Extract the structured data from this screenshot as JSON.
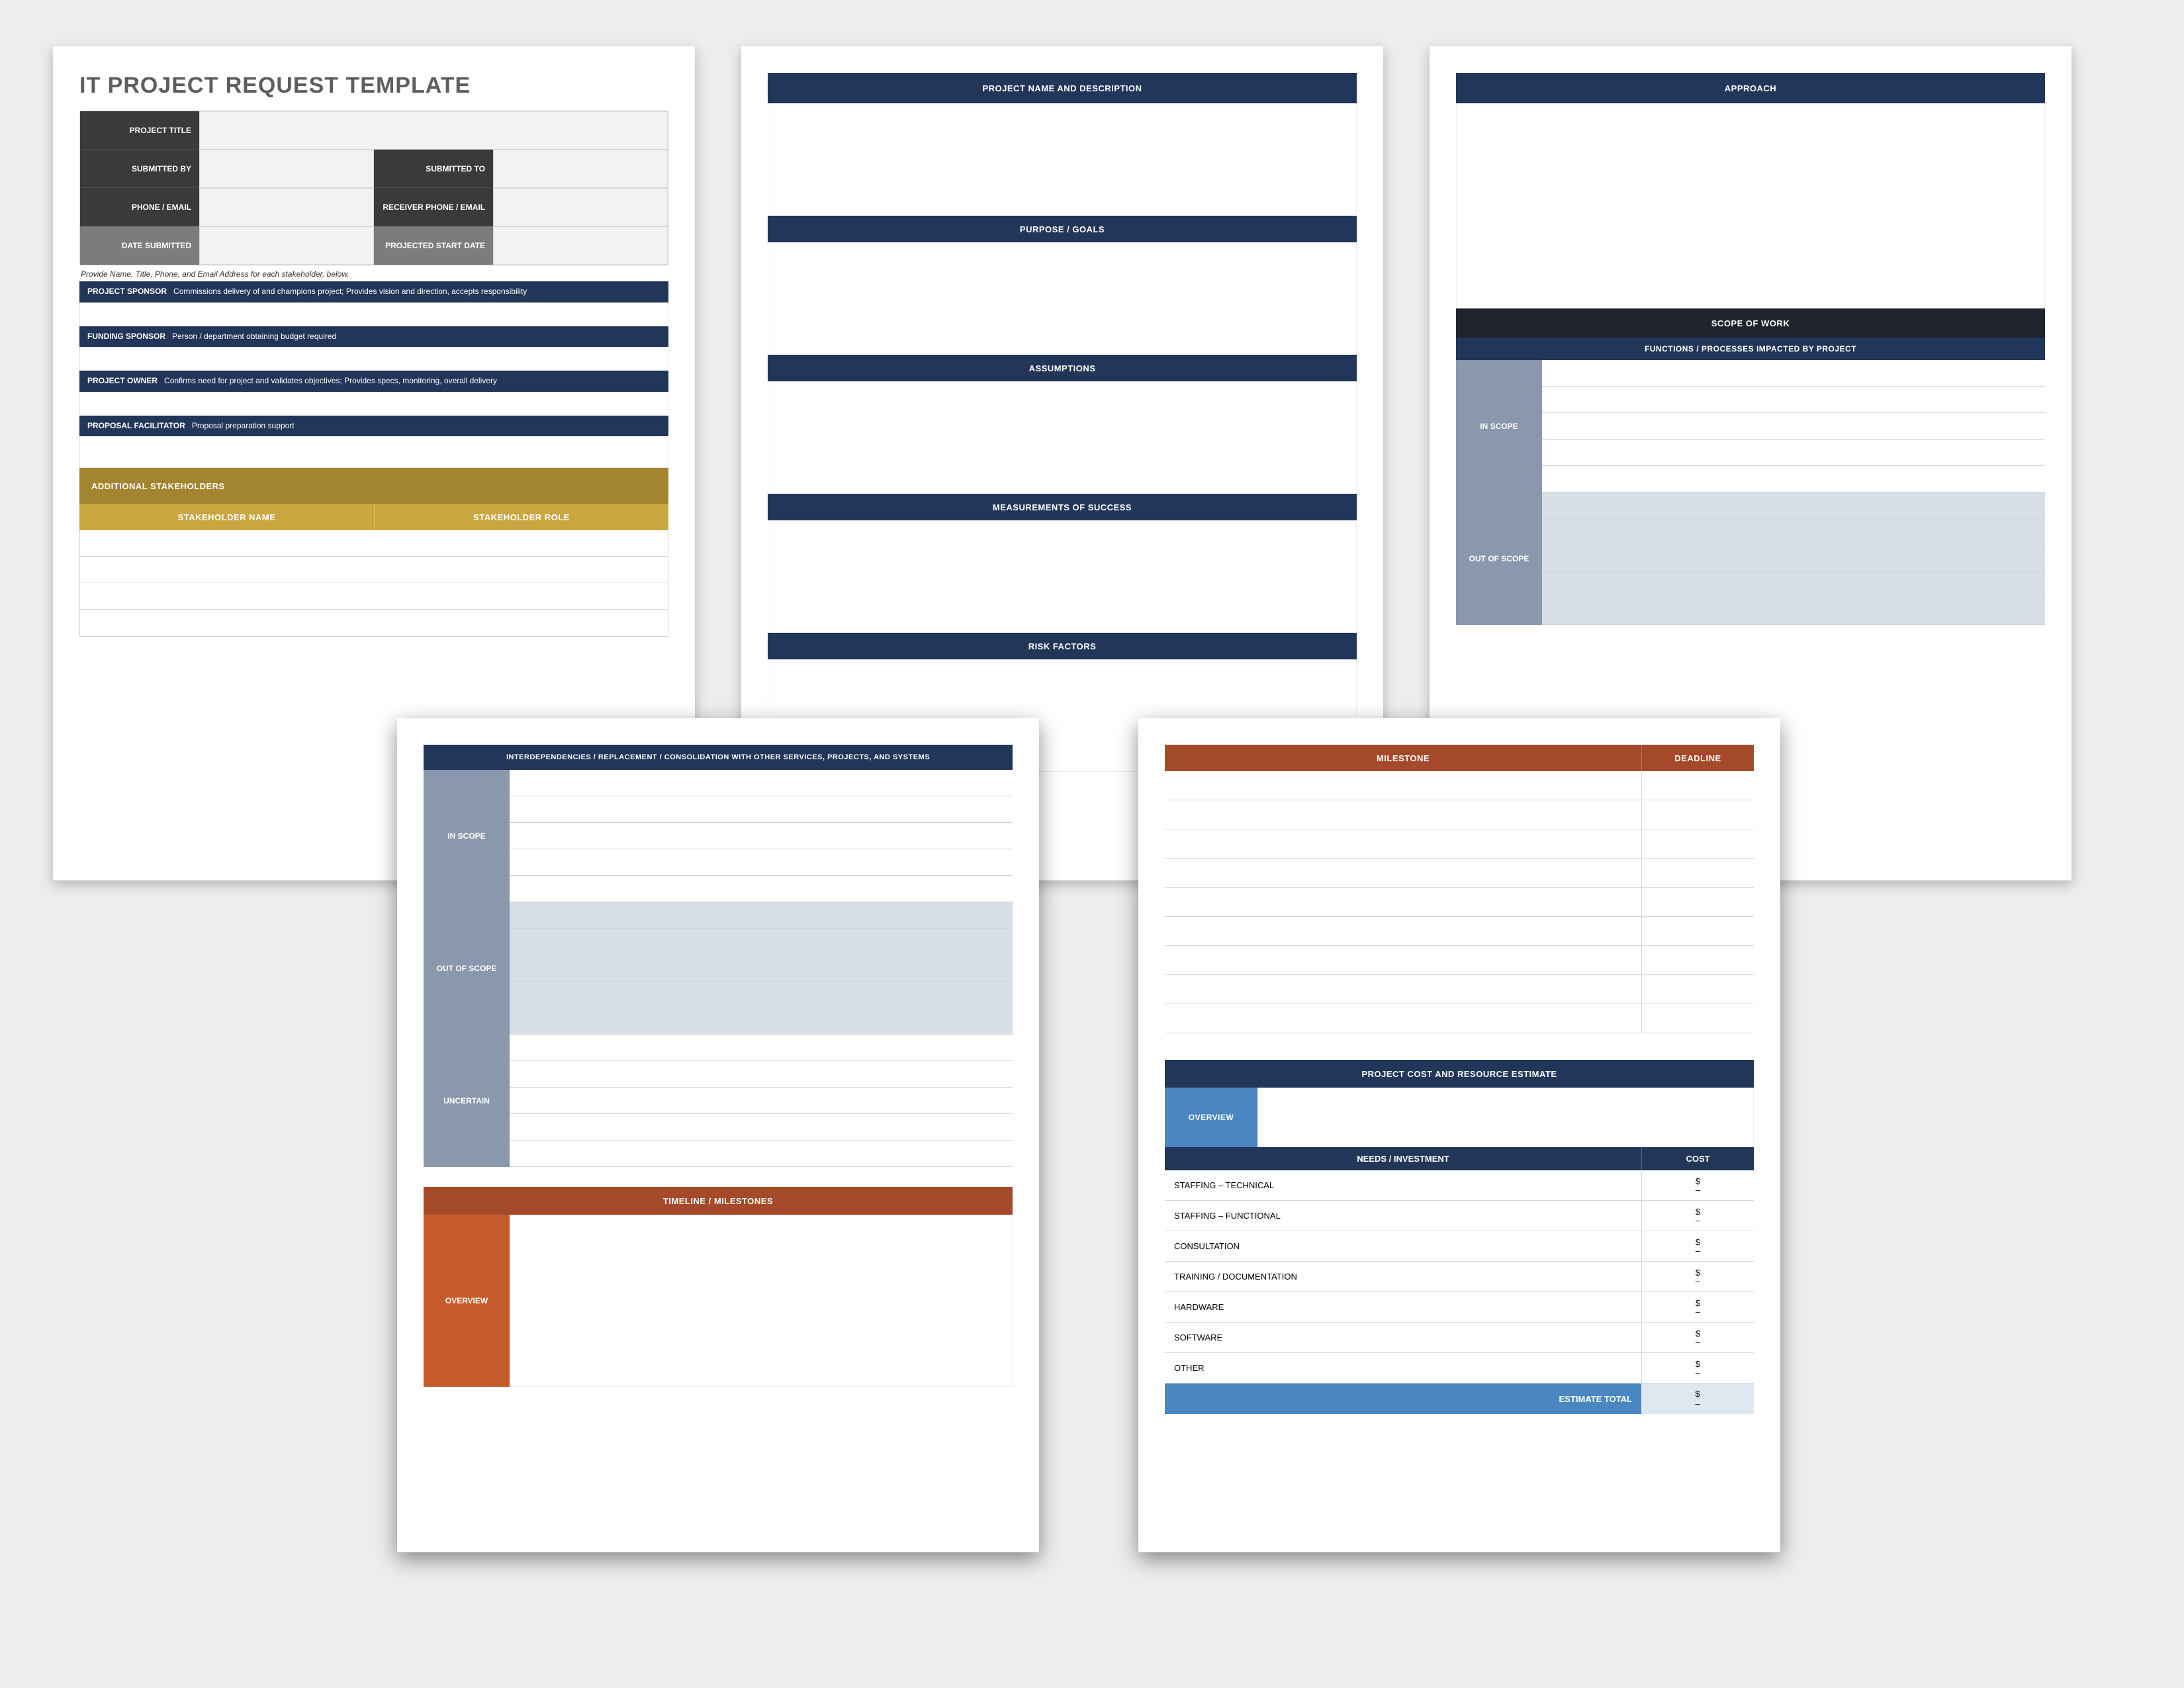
{
  "page1": {
    "title": "IT PROJECT REQUEST TEMPLATE",
    "fields": {
      "project_title": "PROJECT TITLE",
      "submitted_by": "SUBMITTED BY",
      "submitted_to": "SUBMITTED TO",
      "phone_email": "PHONE / EMAIL",
      "receiver_phone_email": "RECEIVER PHONE / EMAIL",
      "date_submitted": "DATE SUBMITTED",
      "projected_start_date": "PROJECTED START  DATE"
    },
    "note": "Provide Name, Title, Phone, and Email Address for each stakeholder, below.",
    "roles": {
      "sponsor_label": "PROJECT SPONSOR",
      "sponsor_desc": "Commissions delivery of and champions project; Provides vision and direction, accepts responsibility",
      "funding_label": "FUNDING SPONSOR",
      "funding_desc": "Person / department obtaining budget required",
      "owner_label": "PROJECT OWNER",
      "owner_desc": "Confirms need for project and validates objectives; Provides specs, monitoring, overall delivery",
      "facilitator_label": "PROPOSAL FACILITATOR",
      "facilitator_desc": "Proposal preparation support"
    },
    "stakeholders": {
      "header": "ADDITIONAL STAKEHOLDERS",
      "col_name": "STAKEHOLDER NAME",
      "col_role": "STAKEHOLDER ROLE"
    }
  },
  "page2": {
    "s1": "PROJECT NAME AND DESCRIPTION",
    "s2": "PURPOSE / GOALS",
    "s3": "ASSUMPTIONS",
    "s4": "MEASUREMENTS OF SUCCESS",
    "s5": "RISK FACTORS"
  },
  "page3": {
    "approach": "APPROACH",
    "scope_header": "SCOPE OF WORK",
    "functions_header": "FUNCTIONS / PROCESSES IMPACTED BY PROJECT",
    "in_scope": "IN SCOPE",
    "out_of_scope": "OUT OF SCOPE"
  },
  "page4": {
    "interdep": "INTERDEPENDENCIES / REPLACEMENT / CONSOLIDATION WITH OTHER SERVICES, PROJECTS, AND SYSTEMS",
    "in_scope": "IN SCOPE",
    "out_of_scope": "OUT OF SCOPE",
    "uncertain": "UNCERTAIN",
    "timeline": "TIMELINE / MILESTONES",
    "overview": "OVERVIEW"
  },
  "page5": {
    "milestone": "MILESTONE",
    "deadline": "DEADLINE",
    "cost_header": "PROJECT COST AND RESOURCE ESTIMATE",
    "overview": "OVERVIEW",
    "needs": "NEEDS / INVESTMENT",
    "cost": "COST",
    "rows": [
      "STAFFING – TECHNICAL",
      "STAFFING – FUNCTIONAL",
      "CONSULTATION",
      "TRAINING / DOCUMENTATION",
      "HARDWARE",
      "SOFTWARE",
      "OTHER"
    ],
    "currency": "$",
    "dash": "–",
    "estimate_total": "ESTIMATE TOTAL"
  }
}
